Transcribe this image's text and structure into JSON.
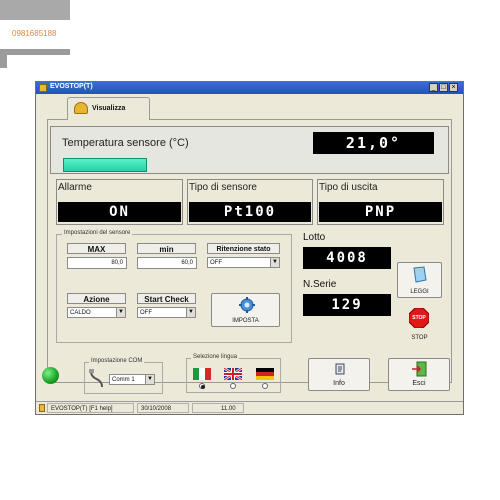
{
  "watermark": {
    "phone": "0981685188"
  },
  "window": {
    "title": "EVOSTOP(T)"
  },
  "tab": {
    "label": "Visualizza"
  },
  "temperature": {
    "label": "Temperatura sensore (°C)",
    "value": "21,0°"
  },
  "alarm": {
    "label": "Allarme",
    "value": "ON"
  },
  "sensor_type": {
    "label": "Tipo di sensore",
    "value": "Pt100"
  },
  "output_type": {
    "label": "Tipo di uscita",
    "value": "PNP"
  },
  "sensor_settings": {
    "title": "Impostazioni del sensore",
    "max_label": "MAX",
    "max_value": "80,0",
    "min_label": "min",
    "min_value": "60,0",
    "retention_label": "Ritenzione stato",
    "retention_value": "OFF",
    "action_label": "Azione",
    "action_value": "CALDO",
    "start_check_label": "Start Check",
    "start_check_value": "OFF",
    "imposta_label": "IMPOSTA"
  },
  "lotto": {
    "label": "Lotto",
    "value": "4008"
  },
  "serial": {
    "label": "N.Serie",
    "value": "129"
  },
  "buttons": {
    "leggi": "LEGGI",
    "stop": "STOP",
    "stop_sign": "STOP",
    "info": "Info",
    "esci": "Esci"
  },
  "com": {
    "title": "Impostazione COM",
    "value": "Comm 1"
  },
  "language": {
    "title": "Selezione lingua"
  },
  "status": {
    "app": "EVOSTOP(T) [F1 help]",
    "date": "30/10/2008",
    "time": "11.00"
  },
  "colors": {
    "led": "#1fa82a",
    "temp_bar": "#2fe0b4",
    "stop_red": "#e01818"
  }
}
